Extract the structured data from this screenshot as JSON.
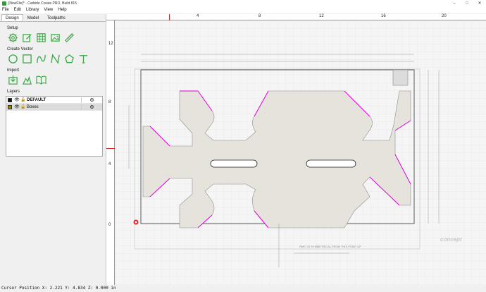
{
  "window": {
    "title": "[NewFile]* - Carbide Create PRO, Build 815"
  },
  "menu": [
    "File",
    "Edit",
    "Library",
    "View",
    "Help"
  ],
  "tabs": [
    {
      "label": "Design",
      "active": true
    },
    {
      "label": "Model",
      "active": false
    },
    {
      "label": "Toolpaths",
      "active": false
    }
  ],
  "sections": {
    "setup": "Setup",
    "create_vector": "Create Vector",
    "import": "Import",
    "layers": "Layers"
  },
  "layers": [
    {
      "name": "DEFAULT",
      "color": "#111111",
      "selected": false,
      "bold": true
    },
    {
      "name": "Boxes",
      "color": "#8a8a00",
      "selected": true,
      "bold": false
    }
  ],
  "ruler": {
    "top_ticks": [
      "4",
      "8",
      "12",
      "16",
      "20"
    ],
    "left_ticks": [
      "12",
      "8",
      "4",
      "0"
    ]
  },
  "drawing": {
    "note": "PART IS SYMMETRICAL FROM THIS POINT UP",
    "logo": "concept",
    "accent": "#e000e0"
  },
  "status": {
    "text": "Cursor Position X: 2.221 Y: 4.834 Z: 0.000 in"
  }
}
